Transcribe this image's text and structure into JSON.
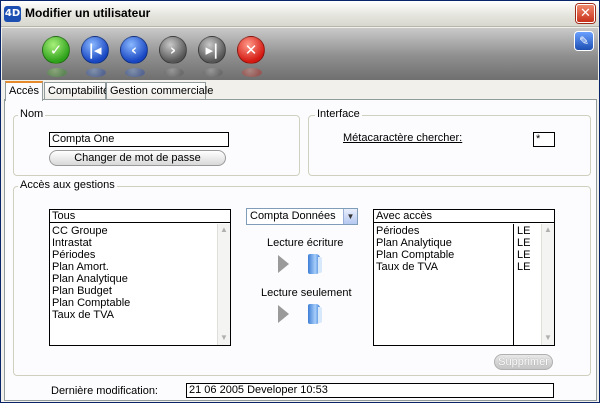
{
  "window": {
    "title": "Modifier un utilisateur",
    "app_icon": "4D",
    "close_glyph": "✕"
  },
  "toolbar": {
    "buttons": [
      {
        "name": "validate",
        "glyph": "✓"
      },
      {
        "name": "first",
        "glyph": "|◂"
      },
      {
        "name": "previous",
        "glyph": "‹"
      },
      {
        "name": "next",
        "glyph": "›"
      },
      {
        "name": "last",
        "glyph": "▸|"
      },
      {
        "name": "cancel",
        "glyph": "✕"
      }
    ],
    "edit_glyph": "✎"
  },
  "tabs": [
    "Accès",
    "Comptabilité",
    "Gestion commerciale"
  ],
  "nom": {
    "legend": "Nom",
    "value": "Compta One",
    "change_password_label": "Changer de mot de passe"
  },
  "interface": {
    "legend": "Interface",
    "wildcard_label": "Métacaractère chercher:",
    "wildcard_value": "*"
  },
  "gestions": {
    "legend": "Accès aux gestions",
    "available": {
      "header": "Tous",
      "items": [
        "CC Groupe",
        "Intrastat",
        "Périodes",
        "Plan Amort.",
        "Plan Analytique",
        "Plan Budget",
        "Plan Comptable",
        "Taux de TVA"
      ]
    },
    "domain_select": "Compta Données",
    "read_write_label": "Lecture écriture",
    "read_only_label": "Lecture seulement",
    "granted": {
      "header": "Avec accès",
      "items": [
        {
          "name": "Périodes",
          "rights": "LE"
        },
        {
          "name": "Plan Analytique",
          "rights": "LE"
        },
        {
          "name": "Plan Comptable",
          "rights": "LE"
        },
        {
          "name": "Taux de TVA",
          "rights": "LE"
        }
      ]
    },
    "delete_label": "Supprimer"
  },
  "last_modified": {
    "label": "Dernière modification:",
    "value": "21 06 2005 Developer 10:53"
  }
}
